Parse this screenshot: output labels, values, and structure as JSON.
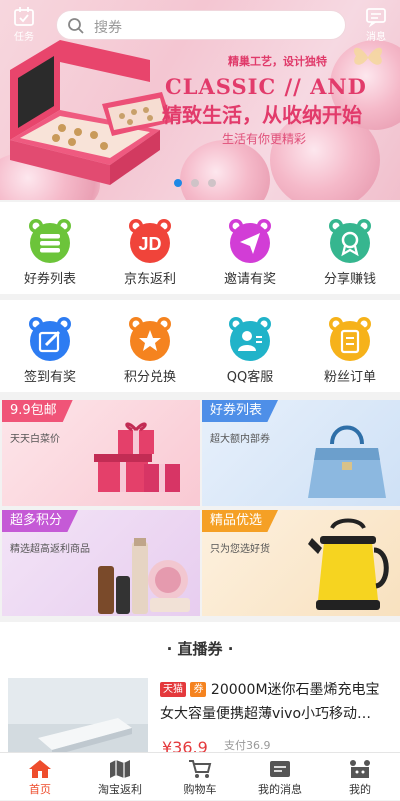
{
  "header": {
    "task_label": "任务",
    "search_placeholder": "搜券",
    "message_label": "消息"
  },
  "banner": {
    "top_text": "精巢工艺，设计独特",
    "title": "CLASSIC // AND",
    "headline": "精致生活，从收纳开始",
    "subtitle": "生活有你更精彩",
    "active_slide": 1,
    "slide_count": 3
  },
  "menu_row1": [
    {
      "label": "好券列表",
      "icon": "coupon-list-icon",
      "color": "#6cc43a"
    },
    {
      "label": "京东返利",
      "icon": "jd-icon",
      "color": "#f0443a"
    },
    {
      "label": "邀请有奖",
      "icon": "send-icon",
      "color": "#d23dd6"
    },
    {
      "label": "分享赚钱",
      "icon": "award-icon",
      "color": "#36b68f"
    }
  ],
  "menu_row2": [
    {
      "label": "签到有奖",
      "icon": "edit-icon",
      "color": "#2d7cf2"
    },
    {
      "label": "积分兑换",
      "icon": "star-icon",
      "color": "#f5831f"
    },
    {
      "label": "QQ客服",
      "icon": "service-icon",
      "color": "#21b3c9"
    },
    {
      "label": "粉丝订单",
      "icon": "order-icon",
      "color": "#f6b21a"
    }
  ],
  "promos": [
    {
      "tag": "9.9包邮",
      "sub": "天天白菜价",
      "tag_color": "#f05478"
    },
    {
      "tag": "好券列表",
      "sub": "超大额内部券",
      "tag_color": "#4e8fe8"
    },
    {
      "tag": "超多积分",
      "sub": "精选超高返利商品",
      "tag_color": "#c55ad6"
    },
    {
      "tag": "精品优选",
      "sub": "只为您选好货",
      "tag_color": "#f5a025"
    }
  ],
  "live": {
    "title": "· 直播券 ·",
    "product": {
      "badge1": "天猫",
      "badge2": "券",
      "title": "20000M迷你石墨烯充电宝女大容量便携超薄vivo小巧移动…",
      "price": "¥36.9",
      "paid": "支付36.9"
    }
  },
  "tabs": [
    {
      "label": "首页",
      "icon": "home-icon",
      "active": true
    },
    {
      "label": "淘宝返利",
      "icon": "map-icon",
      "active": false
    },
    {
      "label": "购物车",
      "icon": "cart-icon",
      "active": false
    },
    {
      "label": "我的消息",
      "icon": "message-icon",
      "active": false
    },
    {
      "label": "我的",
      "icon": "profile-icon",
      "active": false
    }
  ]
}
